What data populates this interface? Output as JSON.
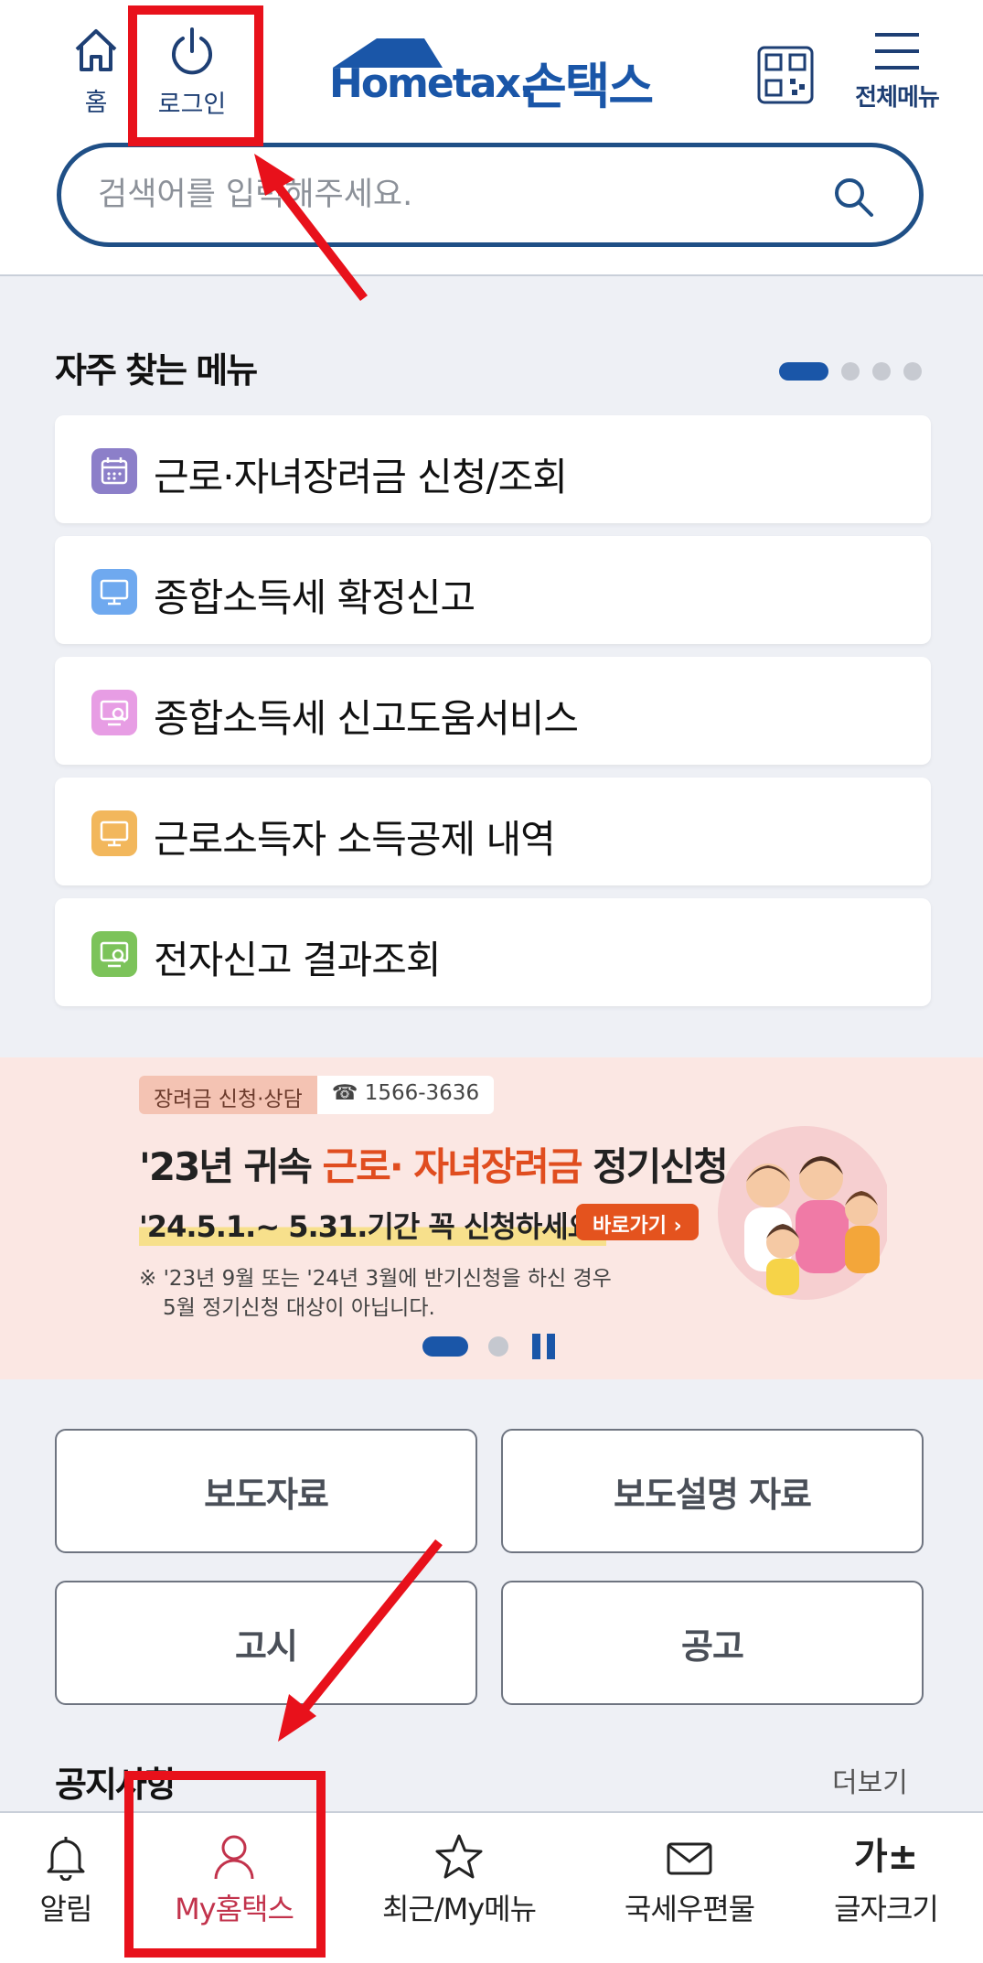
{
  "header": {
    "home_label": "홈",
    "login_label": "로그인",
    "logo_text": "Hometax.",
    "logo_kor": "손택스",
    "menu_label": "전체메뉴",
    "search_placeholder": "검색어를 입력해주세요."
  },
  "freq_menu": {
    "title": "자주 찾는 메뉴",
    "items": [
      {
        "label": "근로·자녀장려금 신청/조회",
        "icon": "calendar-icon",
        "color": "#8c7fc9"
      },
      {
        "label": "종합소득세 확정신고",
        "icon": "monitor-icon",
        "color": "#6fa9ef"
      },
      {
        "label": "종합소득세 신고도움서비스",
        "icon": "monitor-search-icon",
        "color": "#e79de4"
      },
      {
        "label": "근로소득자 소득공제 내역",
        "icon": "monitor-icon",
        "color": "#f2b75c"
      },
      {
        "label": "전자신고 결과조회",
        "icon": "monitor-search-icon",
        "color": "#7cc35a"
      }
    ]
  },
  "banner": {
    "tag_a": "장려금 신청·상담",
    "tag_b": "☎ 1566-3636",
    "title_pre": "'23년 귀속 ",
    "title_hl": "근로· 자녀장려금",
    "title_post": " 정기신청",
    "subtitle": "'24.5.1.~ 5.31.기간 꼭 신청하세요!",
    "go_label": "바로가기 ›",
    "note_line1": "※ '23년 9월 또는 '24년 3월에 반기신청을 하신 경우",
    "note_line2": "5월 정기신청 대상이 아닙니다."
  },
  "grid_buttons": [
    "보도자료",
    "보도설명 자료",
    "고시",
    "공고"
  ],
  "notice": {
    "title": "공지사항",
    "more": "더보기"
  },
  "bottom_nav": [
    {
      "label": "알림",
      "icon": "bell-icon"
    },
    {
      "label": "My홈택스",
      "icon": "person-icon",
      "active": true
    },
    {
      "label": "최근/My메뉴",
      "icon": "star-icon"
    },
    {
      "label": "국세우편물",
      "icon": "mail-icon"
    },
    {
      "label": "글자크기",
      "icon": "font-size-icon",
      "glyph": "가±"
    }
  ],
  "colors": {
    "brand": "#1a56a8",
    "active_nav": "#c2334c",
    "annotation": "#e8111b"
  }
}
